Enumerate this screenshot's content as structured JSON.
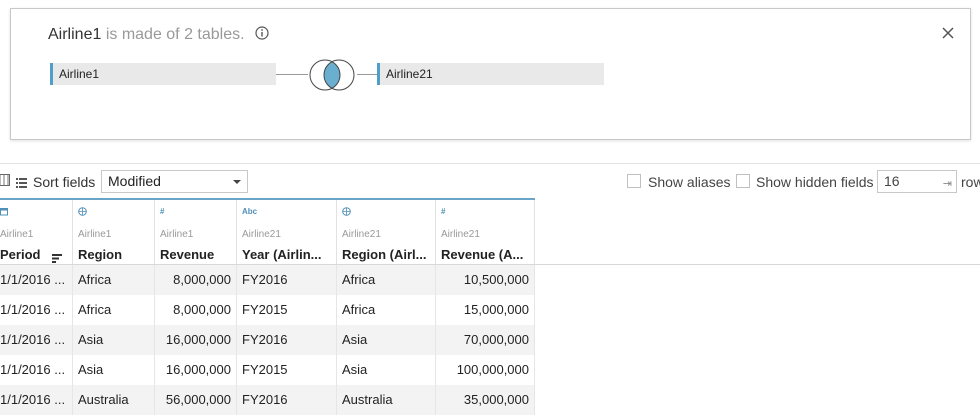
{
  "join": {
    "datasource": "Airline1",
    "subtitle": "is made of 2 tables.",
    "left_table": "Airline1",
    "right_table": "Airline21"
  },
  "toolbar": {
    "sort_label": "Sort fields",
    "sort_value": "Modified",
    "show_aliases": "Show aliases",
    "show_hidden": "Show hidden fields",
    "rows_value": "16",
    "rows_label": "rows"
  },
  "columns": [
    {
      "icon": "date-icon",
      "source": "Airline1",
      "name": "Period",
      "sorted": true
    },
    {
      "icon": "globe-icon",
      "source": "Airline1",
      "name": "Region"
    },
    {
      "icon": "number-icon",
      "source": "Airline1",
      "name": "Revenue"
    },
    {
      "icon": "string-icon",
      "source": "Airline21",
      "name": "Year (Airlin..."
    },
    {
      "icon": "globe-icon",
      "source": "Airline21",
      "name": "Region (Airl..."
    },
    {
      "icon": "number-icon",
      "source": "Airline21",
      "name": "Revenue (A..."
    }
  ],
  "rows": [
    [
      "1/1/2016 ...",
      "Africa",
      "8,000,000",
      "FY2016",
      "Africa",
      "10,500,000"
    ],
    [
      "1/1/2016 ...",
      "Africa",
      "8,000,000",
      "FY2015",
      "Africa",
      "15,000,000"
    ],
    [
      "1/1/2016 ...",
      "Asia",
      "16,000,000",
      "FY2016",
      "Asia",
      "70,000,000"
    ],
    [
      "1/1/2016 ...",
      "Asia",
      "16,000,000",
      "FY2015",
      "Asia",
      "100,000,000"
    ],
    [
      "1/1/2016 ...",
      "Australia",
      "56,000,000",
      "FY2016",
      "Australia",
      "35,000,000"
    ]
  ],
  "colors": {
    "accent": "#4f9fc9",
    "venn_fill": "#6aaed0"
  }
}
